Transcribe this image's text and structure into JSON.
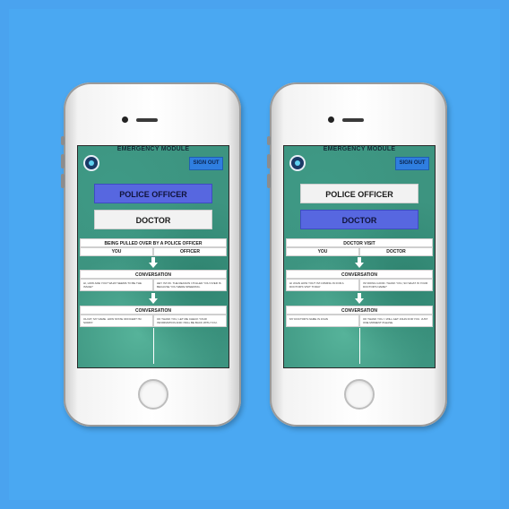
{
  "screens": [
    {
      "module_title": "EMERGENCY MODULE",
      "sign_out": "SIGN OUT",
      "roles": [
        {
          "label": "POLICE OFFICER",
          "active": true
        },
        {
          "label": "DOCTOR",
          "active": false
        }
      ],
      "scenario_title": "BEING PULLED OVER BY A POLICE OFFICER",
      "columns": [
        "YOU",
        "OFFICER"
      ],
      "sections": [
        {
          "header": "CONVERSATION",
          "left": "HI, HOW ARE YOU? WHAT SEEMS TO BE THE ISSUE?",
          "right": "HEY I'M OK. THE REASON I PULLED YOU OVER IS BECAUSE YOU WERE SPEEDING."
        },
        {
          "header": "CONVERSATION",
          "left": "OH MY, MY NAME. HOW STATE OFFICER? I'M SORRY.",
          "right": "OK THANK YOU, LET ME CHECK YOUR INFORMATION AND I WILL BE BACK WITH YOU."
        }
      ]
    },
    {
      "module_title": "EMERGENCY MODULE",
      "sign_out": "SIGN OUT",
      "roles": [
        {
          "label": "POLICE OFFICER",
          "active": false
        },
        {
          "label": "DOCTOR",
          "active": true
        }
      ],
      "scenario_title": "DOCTOR VISIT",
      "columns": [
        "YOU",
        "DOCTOR"
      ],
      "sections": [
        {
          "header": "CONVERSATION",
          "left": "HI JOHN HOW YOU? I'M COMING IN FOR A DOCTOR'S VISIT TODAY",
          "right": "I'M DOING GOOD. THANK YOU, SO WHAT IS YOUR DOCTOR'S NAME?"
        },
        {
          "header": "CONVERSATION",
          "left": "MY DOCTOR'S NAME IS JOHN",
          "right": "OK THANK YOU. I WILL GET JOHN FOR YOU. JUST ONE MOMENT PLEASE."
        }
      ]
    }
  ]
}
